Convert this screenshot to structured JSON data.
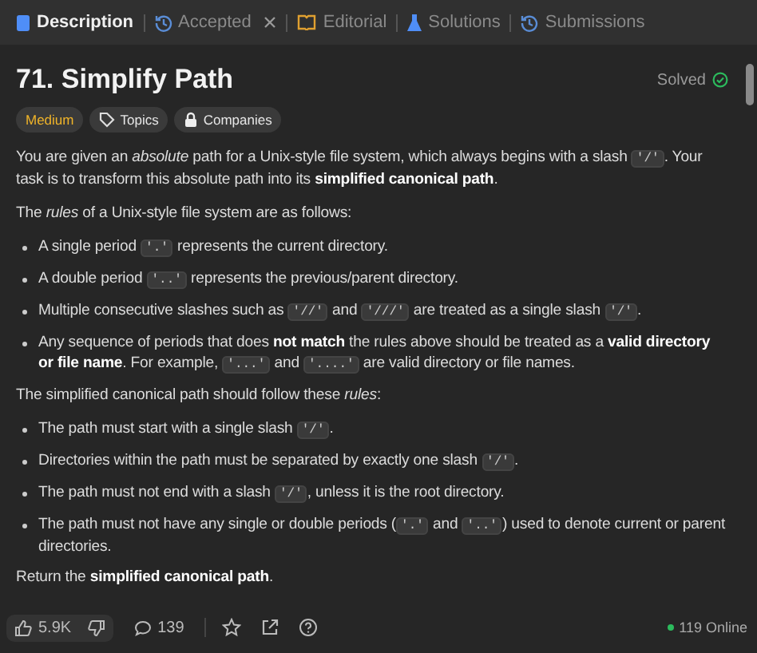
{
  "tabs": [
    {
      "label": "Description",
      "selected": true,
      "closable": false
    },
    {
      "label": "Accepted",
      "selected": false,
      "closable": true
    },
    {
      "label": "Editorial",
      "selected": false,
      "closable": false
    },
    {
      "label": "Solutions",
      "selected": false,
      "closable": false
    },
    {
      "label": "Submissions",
      "selected": false,
      "closable": false
    }
  ],
  "title": "71. Simplify Path",
  "status": "Solved",
  "difficulty": "Medium",
  "tags": [
    "Topics",
    "Companies"
  ],
  "content": [
    {
      "kind": "p",
      "segments": [
        {
          "kind": "text",
          "t": "You are given an *absolute* path for a Unix-style file system, which always begins with a slash "
        },
        {
          "kind": "code",
          "t": "'/'"
        },
        {
          "kind": "text",
          "t": ". Your task is to transform this absolute path into its **simplified canonical path**."
        }
      ]
    },
    {
      "kind": "p",
      "segments": [
        {
          "kind": "text",
          "t": "The *rules* of a Unix-style file system are as follows:"
        }
      ]
    },
    {
      "kind": "li",
      "segments": [
        {
          "kind": "text",
          "t": "A single period "
        },
        {
          "kind": "code",
          "t": "'.'"
        },
        {
          "kind": "text",
          "t": " represents the current directory."
        }
      ]
    },
    {
      "kind": "li",
      "segments": [
        {
          "kind": "text",
          "t": "A double period "
        },
        {
          "kind": "code",
          "t": "'..'"
        },
        {
          "kind": "text",
          "t": " represents the previous/parent directory."
        }
      ]
    },
    {
      "kind": "li",
      "segments": [
        {
          "kind": "text",
          "t": "Multiple consecutive slashes such as "
        },
        {
          "kind": "code",
          "t": "'//'"
        },
        {
          "kind": "text",
          "t": " and "
        },
        {
          "kind": "code",
          "t": "'///'"
        },
        {
          "kind": "text",
          "t": " are treated as a single slash "
        },
        {
          "kind": "code",
          "t": "'/'"
        },
        {
          "kind": "text",
          "t": "."
        }
      ]
    },
    {
      "kind": "li",
      "segments": [
        {
          "kind": "text",
          "t": "Any sequence of periods that does **not match** the rules above should be treated as a **valid directory or file name**. For example, "
        },
        {
          "kind": "code",
          "t": "'...'"
        },
        {
          "kind": "text",
          "t": " and "
        },
        {
          "kind": "code",
          "t": "'....'"
        },
        {
          "kind": "text",
          "t": " are valid directory or file names."
        }
      ]
    },
    {
      "kind": "p",
      "segments": [
        {
          "kind": "text",
          "t": "The simplified canonical path should follow these *rules*:"
        }
      ]
    },
    {
      "kind": "li",
      "segments": [
        {
          "kind": "text",
          "t": "The path must start with a single slash "
        },
        {
          "kind": "code",
          "t": "'/'"
        },
        {
          "kind": "text",
          "t": "."
        }
      ]
    },
    {
      "kind": "li",
      "segments": [
        {
          "kind": "text",
          "t": "Directories within the path must be separated by exactly one slash "
        },
        {
          "kind": "code",
          "t": "'/'"
        },
        {
          "kind": "text",
          "t": "."
        }
      ]
    },
    {
      "kind": "li",
      "segments": [
        {
          "kind": "text",
          "t": "The path must not end with a slash "
        },
        {
          "kind": "code",
          "t": "'/'"
        },
        {
          "kind": "text",
          "t": ", unless it is the root directory."
        }
      ]
    },
    {
      "kind": "li",
      "segments": [
        {
          "kind": "text",
          "t": "The path must not have any single or double periods ("
        },
        {
          "kind": "code",
          "t": "'.'"
        },
        {
          "kind": "text",
          "t": " and "
        },
        {
          "kind": "code",
          "t": "'..'"
        },
        {
          "kind": "text",
          "t": ") used to denote current or parent directories."
        }
      ]
    },
    {
      "kind": "p",
      "segments": [
        {
          "kind": "text",
          "t": "Return the **simplified canonical path**."
        }
      ]
    }
  ],
  "footer": {
    "likes": "5.9K",
    "comments": "139",
    "online": "119 Online"
  }
}
